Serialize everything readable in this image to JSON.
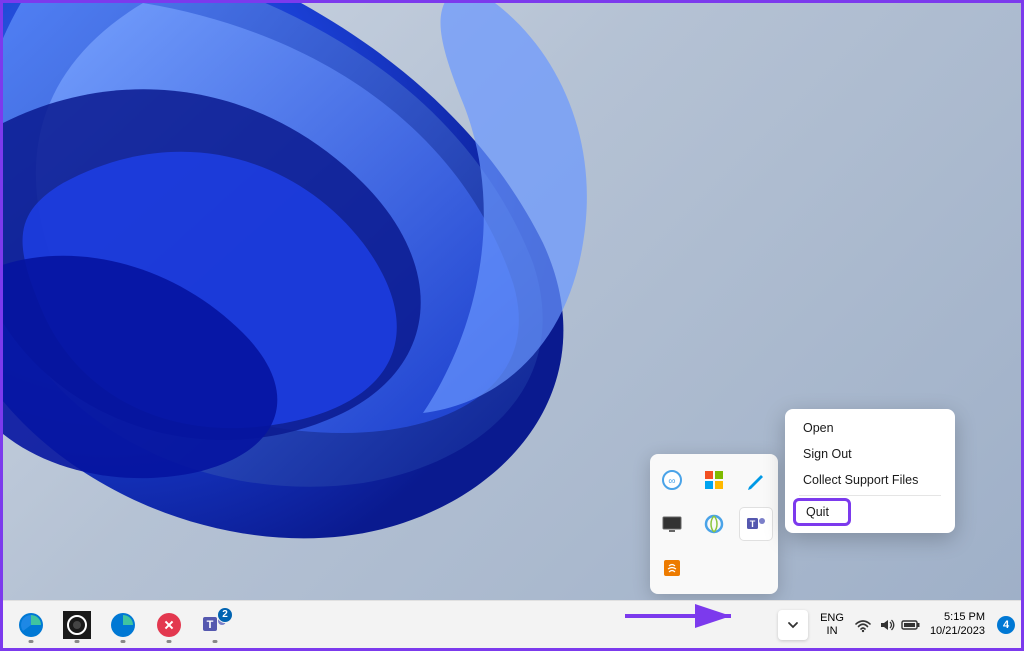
{
  "contextMenu": {
    "items": [
      {
        "label": "Open"
      },
      {
        "label": "Sign Out"
      },
      {
        "label": "Collect Support Files"
      }
    ],
    "highlightedItem": "Quit"
  },
  "trayFlyout": {
    "icons": [
      {
        "name": "zoom",
        "color": "#4aa3e8"
      },
      {
        "name": "ms-store",
        "color": "#d13438"
      },
      {
        "name": "pen",
        "color": "#0099e6"
      },
      {
        "name": "display",
        "color": "#333333"
      },
      {
        "name": "internet-explorer",
        "color": "#4aa3e8"
      },
      {
        "name": "teams",
        "color": "#5558af",
        "highlighted": true
      },
      {
        "name": "java",
        "color": "#ed7b00"
      }
    ]
  },
  "taskbar": {
    "items": [
      {
        "name": "edge",
        "hasIndicator": true
      },
      {
        "name": "obs",
        "hasIndicator": true
      },
      {
        "name": "edge-secondary",
        "hasIndicator": true
      },
      {
        "name": "zoho",
        "hasIndicator": true
      },
      {
        "name": "teams",
        "badge": "2",
        "hasIndicator": true
      }
    ],
    "language": {
      "primary": "ENG",
      "secondary": "IN"
    },
    "clock": {
      "time": "5:15 PM",
      "date": "10/21/2023"
    },
    "notificationCount": "4"
  },
  "colors": {
    "highlight": "#7c3aed",
    "badge": "#0078d4"
  }
}
